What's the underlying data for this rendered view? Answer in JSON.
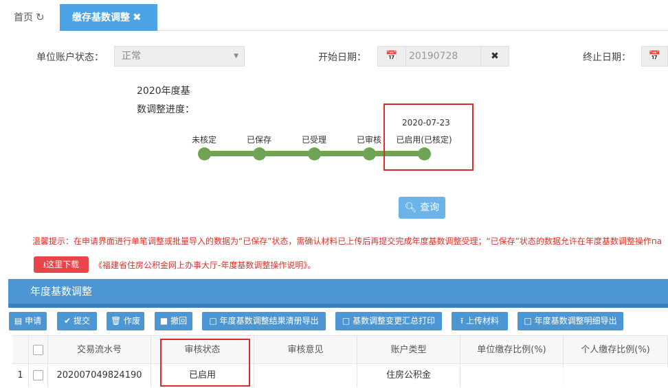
{
  "tabs": {
    "home_label": "首页",
    "active_label": "缴存基数调整"
  },
  "form": {
    "account_status_label": "单位账户状态：",
    "account_status_value": "正常",
    "start_date_label": "开始日期：",
    "start_date_value": "20190728",
    "end_date_label": "终止日期："
  },
  "progress": {
    "title": "2020年度基数调整进度：",
    "steps": [
      "未核定",
      "已保存",
      "已受理",
      "已审核",
      "已启用(已核定)"
    ],
    "current_step_date": "2020-07-23",
    "current_step_index": 4
  },
  "query_button": "查询",
  "notice": {
    "text": "温馨提示：在申请界面进行单笔调整或批量导入的数据为“已保存”状态，需确认材料已上传后再提交完成年度基数调整受理；“已保存”状态的数据允许在年度基数调整操作па",
    "download_button": "这里下载",
    "download_note": "《福建省住房公积金网上办事大厅-年度基数调整操作说明》。"
  },
  "panel": {
    "title": "年度基数调整",
    "toolbar": [
      "申请",
      "提交",
      "作废",
      "撤回",
      "年度基数调整结果清册导出",
      "基数调整变更汇总打印",
      "上传材料",
      "年度基数调整明细导出"
    ]
  },
  "table": {
    "columns": [
      "交易流水号",
      "审核状态",
      "审核意见",
      "账户类型",
      "单位缴存比例(%)",
      "个人缴存比例(%)"
    ],
    "rows": [
      {
        "index": "1",
        "serial": "202007049824190",
        "status": "已启用",
        "opinion": "",
        "account_type": "住房公积金",
        "unit_ratio": "",
        "personal_ratio": ""
      }
    ]
  }
}
